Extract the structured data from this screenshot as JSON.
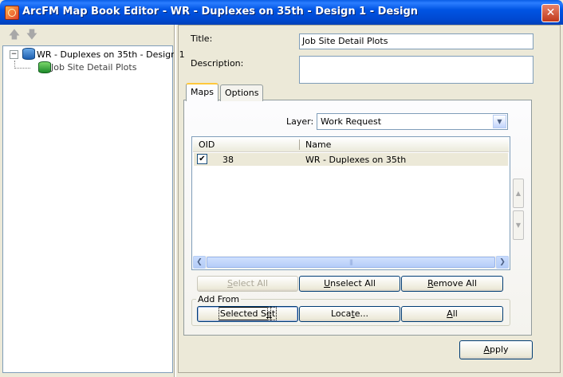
{
  "window": {
    "title": "ArcFM Map Book Editor - WR - Duplexes on 35th - Design 1 - Design",
    "close_glyph": "✕"
  },
  "tree": {
    "up_arrow": "🡅",
    "down_arrow": "🡇",
    "expander": "−",
    "root_label": "WR - Duplexes on 35th - Design 1",
    "child_label": "Job Site Detail Plots"
  },
  "form": {
    "title_label": "Title:",
    "title_value": "Job Site Detail Plots",
    "description_label": "Description:",
    "description_value": ""
  },
  "tabs": [
    {
      "label": "Maps",
      "active": true
    },
    {
      "label": "Options",
      "active": false
    }
  ],
  "maps": {
    "layer_label": "Layer:",
    "layer_value": "Work Request",
    "dropdown_glyph": "▼",
    "columns": [
      "OID",
      "Name"
    ],
    "rows": [
      {
        "checked": true,
        "oid": "38",
        "name": "WR - Duplexes on 35th"
      }
    ],
    "check_glyph": "✔",
    "scroll_left": "❮",
    "scroll_right": "❯",
    "scroll_grip": "|||",
    "move_up_glyph": "▲",
    "move_down_glyph": "▼",
    "buttons": {
      "select_all": {
        "pre": "",
        "key": "S",
        "post": "elect All"
      },
      "unselect_all": {
        "pre": "",
        "key": "U",
        "post": "nselect All"
      },
      "remove_all": {
        "pre": "",
        "key": "R",
        "post": "emove All"
      }
    },
    "add_from": {
      "label": "Add From",
      "selected_set": {
        "pre": "Selected S",
        "key": "e",
        "post": "t"
      },
      "locate": {
        "pre": "Loca",
        "key": "t",
        "post": "e..."
      },
      "all": {
        "pre": "",
        "key": "A",
        "post": "ll"
      }
    }
  },
  "apply": {
    "pre": "",
    "key": "A",
    "post": "pply"
  }
}
